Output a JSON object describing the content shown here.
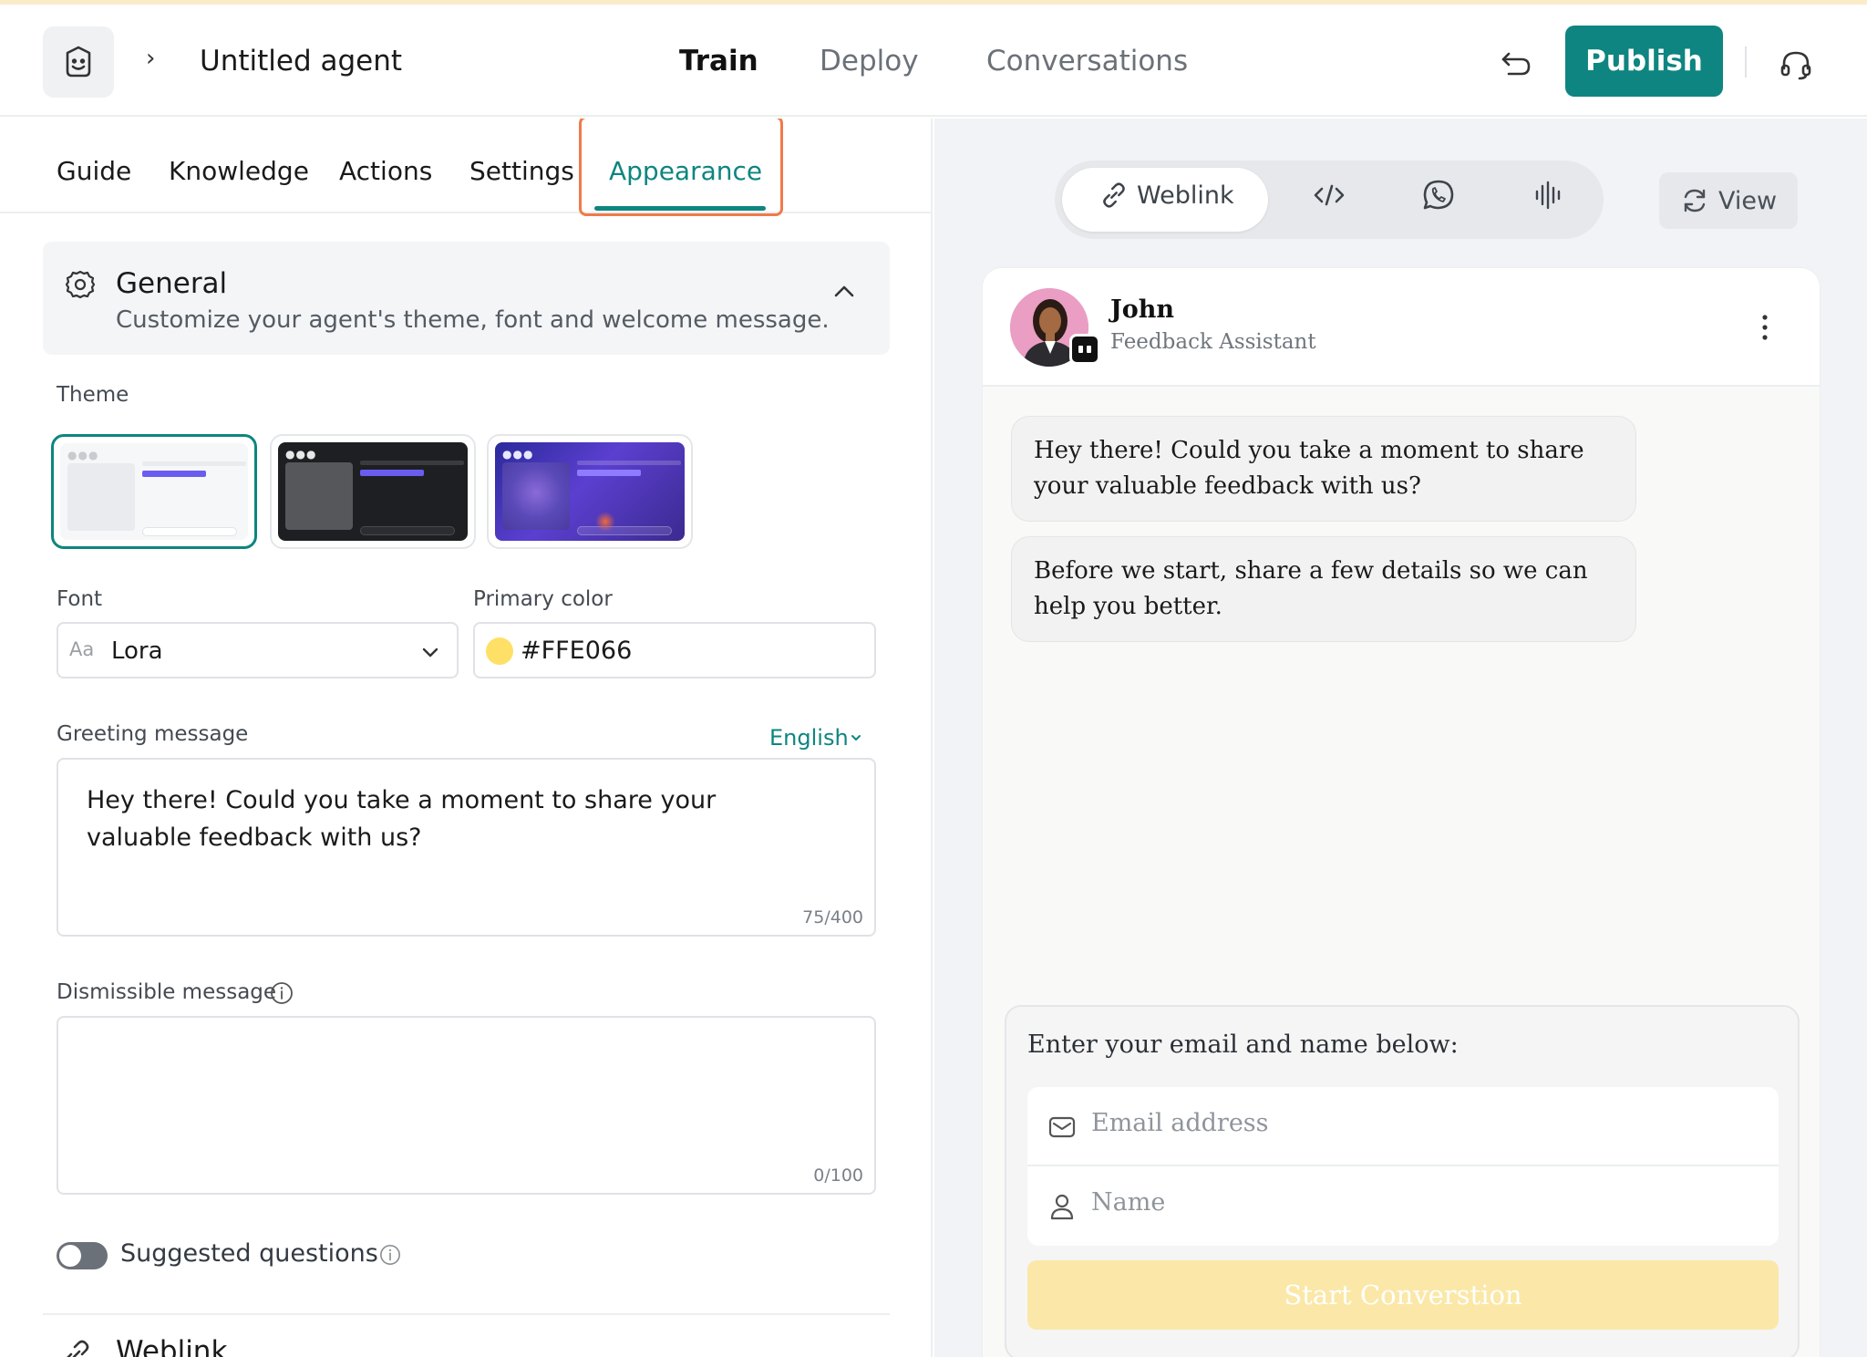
{
  "header": {
    "agent_title": "Untitled agent",
    "nav": [
      {
        "label": "Train",
        "active": true
      },
      {
        "label": "Deploy",
        "active": false
      },
      {
        "label": "Conversations",
        "active": false
      }
    ],
    "publish_label": "Publish",
    "icons": {
      "logo": "smiley-box-icon",
      "breadcrumb": "chevron-right-icon",
      "undo": "undo-icon",
      "support": "headset-icon"
    }
  },
  "subtabs": [
    "Guide",
    "Knowledge",
    "Actions",
    "Settings",
    "Appearance"
  ],
  "subtabs_active": "Appearance",
  "general": {
    "title": "General",
    "description": "Customize your agent's theme, font and welcome message."
  },
  "theme": {
    "label": "Theme",
    "options": [
      "light",
      "dark",
      "gradient"
    ],
    "selected": "light"
  },
  "font": {
    "label": "Font",
    "prefix": "Aa",
    "value": "Lora"
  },
  "primary_color": {
    "label": "Primary color",
    "value": "#FFE066"
  },
  "greeting": {
    "label": "Greeting message",
    "language": "English",
    "value": "Hey there! Could you take a moment to share your valuable feedback with us?",
    "count": "75/400"
  },
  "dismissible": {
    "label": "Dismissible message",
    "value": "",
    "count": "0/100"
  },
  "suggested": {
    "label": "Suggested questions",
    "enabled": false
  },
  "weblink_section": {
    "title": "Weblink"
  },
  "preview": {
    "channels": [
      {
        "label": "Weblink",
        "icon": "link-icon",
        "active": true
      },
      {
        "label": "",
        "icon": "code-icon",
        "active": false
      },
      {
        "label": "",
        "icon": "whatsapp-icon",
        "active": false
      },
      {
        "label": "",
        "icon": "voice-wave-icon",
        "active": false
      }
    ],
    "view_label": "View",
    "agent_name": "John",
    "agent_role": "Feedback Assistant",
    "messages": [
      "Hey there! Could you take a moment to share your valuable feedback with us?",
      "Before we start, share a few details so we can help you better."
    ],
    "form": {
      "title": "Enter your email and name below:",
      "email_placeholder": "Email address",
      "name_placeholder": "Name",
      "button": "Start Converstion"
    }
  },
  "colors": {
    "brand": "#0e8580",
    "highlight": "#f07a4a",
    "primary": "#FFE066"
  }
}
